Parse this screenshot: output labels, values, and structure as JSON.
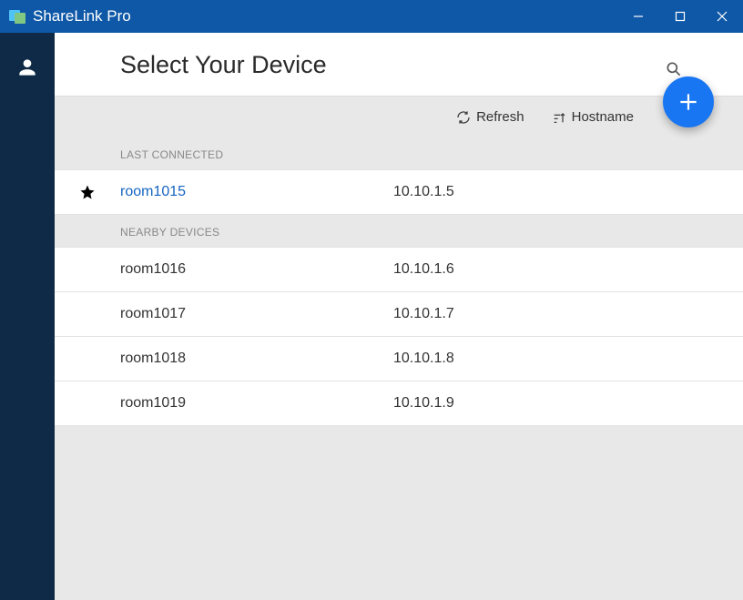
{
  "window": {
    "title": "ShareLink Pro"
  },
  "header": {
    "title": "Select Your Device"
  },
  "toolbar": {
    "refresh": "Refresh",
    "hostname": "Hostname"
  },
  "sections": {
    "last": {
      "label": "LAST CONNECTED"
    },
    "nearby": {
      "label": "NEARBY DEVICES"
    }
  },
  "last_connected": [
    {
      "name": "room1015",
      "ip": "10.10.1.5"
    }
  ],
  "nearby": [
    {
      "name": "room1016",
      "ip": "10.10.1.6"
    },
    {
      "name": "room1017",
      "ip": "10.10.1.7"
    },
    {
      "name": "room1018",
      "ip": "10.10.1.8"
    },
    {
      "name": "room1019",
      "ip": "10.10.1.9"
    }
  ]
}
